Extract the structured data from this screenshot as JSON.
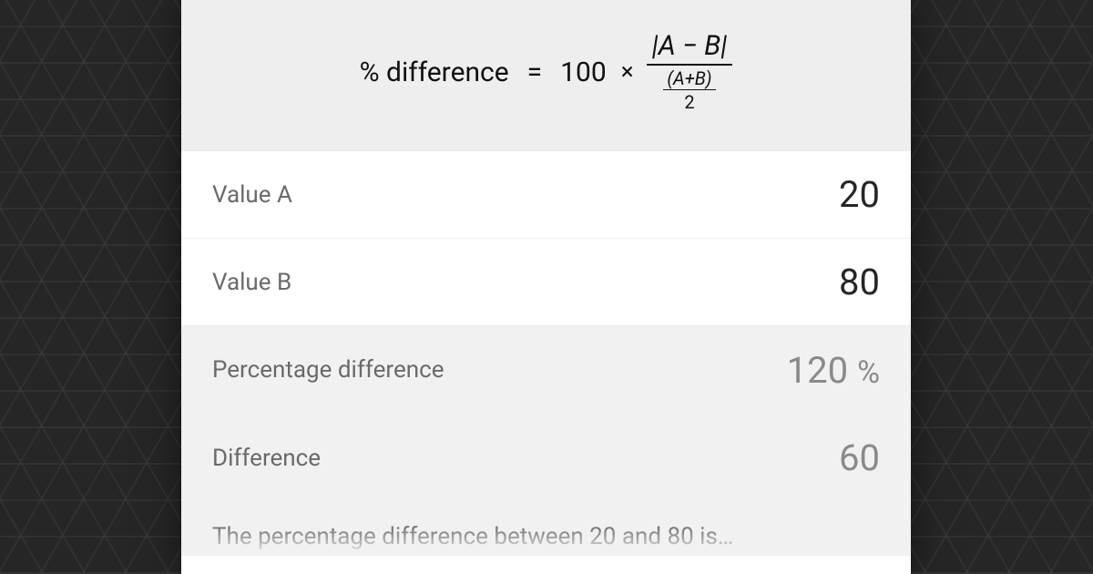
{
  "formula": {
    "lhs": "% difference",
    "equals": "=",
    "constant": "100",
    "times": "×",
    "numerator": "|A − B|",
    "denominator_numer": "(A+B)",
    "denominator_denom": "2"
  },
  "inputs": {
    "value_a": {
      "label": "Value A",
      "value": "20"
    },
    "value_b": {
      "label": "Value B",
      "value": "80"
    }
  },
  "results": {
    "percentage_difference": {
      "label": "Percentage difference",
      "value": "120",
      "unit": "%"
    },
    "difference": {
      "label": "Difference",
      "value": "60"
    }
  },
  "summary_text": "The percentage difference between 20 and 80 is…"
}
